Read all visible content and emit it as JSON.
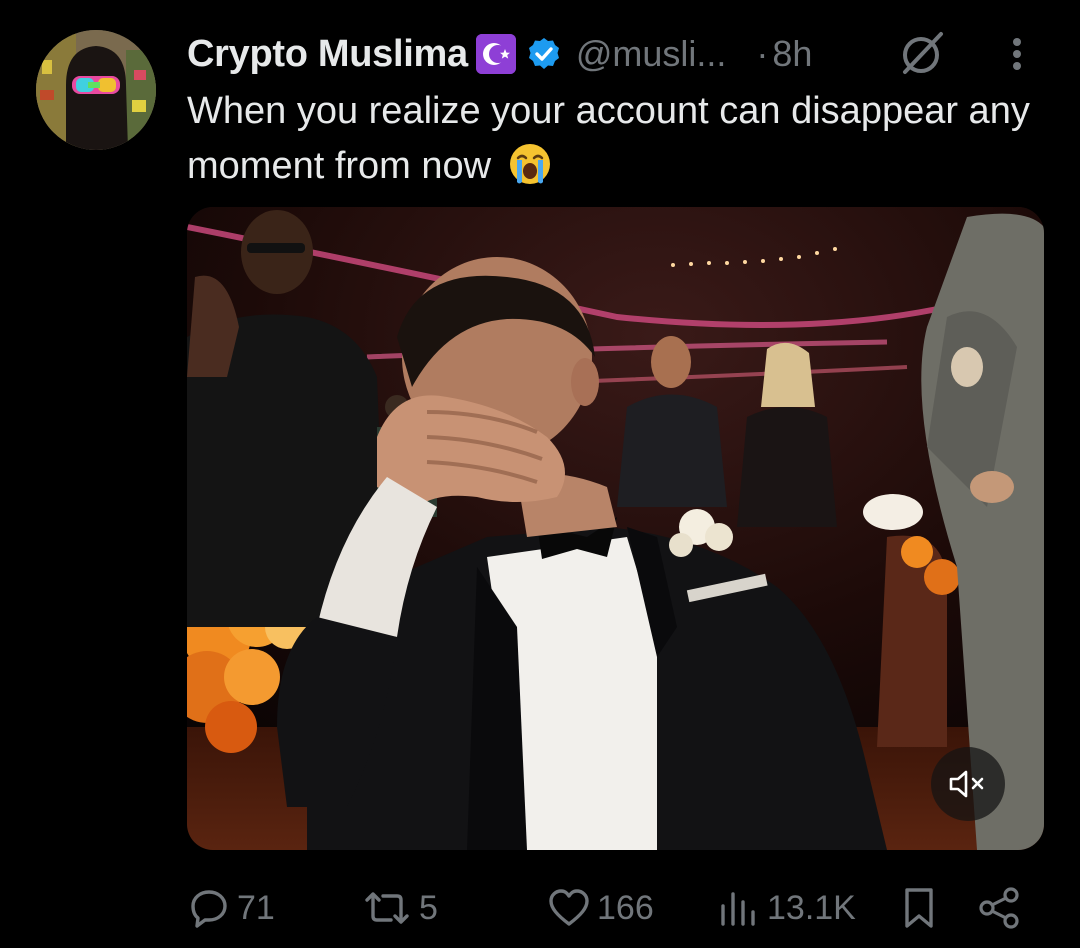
{
  "author": {
    "display_name": "Crypto Muslima",
    "flag_emoji": "star-and-crescent",
    "verified": true,
    "handle": "@musli...",
    "separator": "·",
    "time": "8h"
  },
  "tweet": {
    "text": "When you realize your account can disappear any moment from now",
    "emoji": "loudly-crying-face"
  },
  "media": {
    "type": "video",
    "muted": true,
    "mute_icon": "speaker-muted-icon"
  },
  "actions": {
    "replies": "71",
    "retweets": "5",
    "likes": "166",
    "views": "13.1K"
  },
  "colors": {
    "background": "#000000",
    "text_primary": "#e7e9ea",
    "text_secondary": "#71767b",
    "verified_blue": "#1d9bf0"
  }
}
